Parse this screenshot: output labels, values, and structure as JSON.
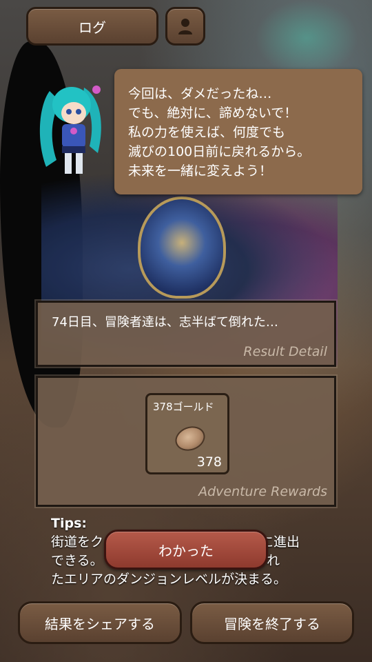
{
  "header": {
    "log_label": "ログ",
    "user_icon": "user-icon"
  },
  "speech": {
    "lines": [
      "今回は、ダメだったね…",
      "でも、絶対に、諦めないで！",
      "私の力を使えば、何度でも",
      "滅びの100日前に戻れるから。",
      "未来を一緒に変えよう！"
    ]
  },
  "result": {
    "text": "74日目、冒険者達は、志半ばて倒れた…",
    "caption": "Result Detail"
  },
  "rewards": {
    "caption": "Adventure Rewards",
    "item_name": "378ゴールド",
    "item_count": "378",
    "item_icon": "gold-coin-icon"
  },
  "tips": {
    "title": "Tips:",
    "lines": [
      "街道をク　　　　　　　　　　　アに進出",
      "できる。　　　　　　　　　　開放され",
      "たエリアのダンジョンレベルが決まる。"
    ]
  },
  "buttons": {
    "ok": "わかった",
    "share": "結果をシェアする",
    "end": "冒険を終了する"
  },
  "colors": {
    "panel_bg": "#735f4e",
    "button_brown": "#6a4d38",
    "button_red": "#9e4636",
    "speech_bg": "#8c6a4c"
  }
}
